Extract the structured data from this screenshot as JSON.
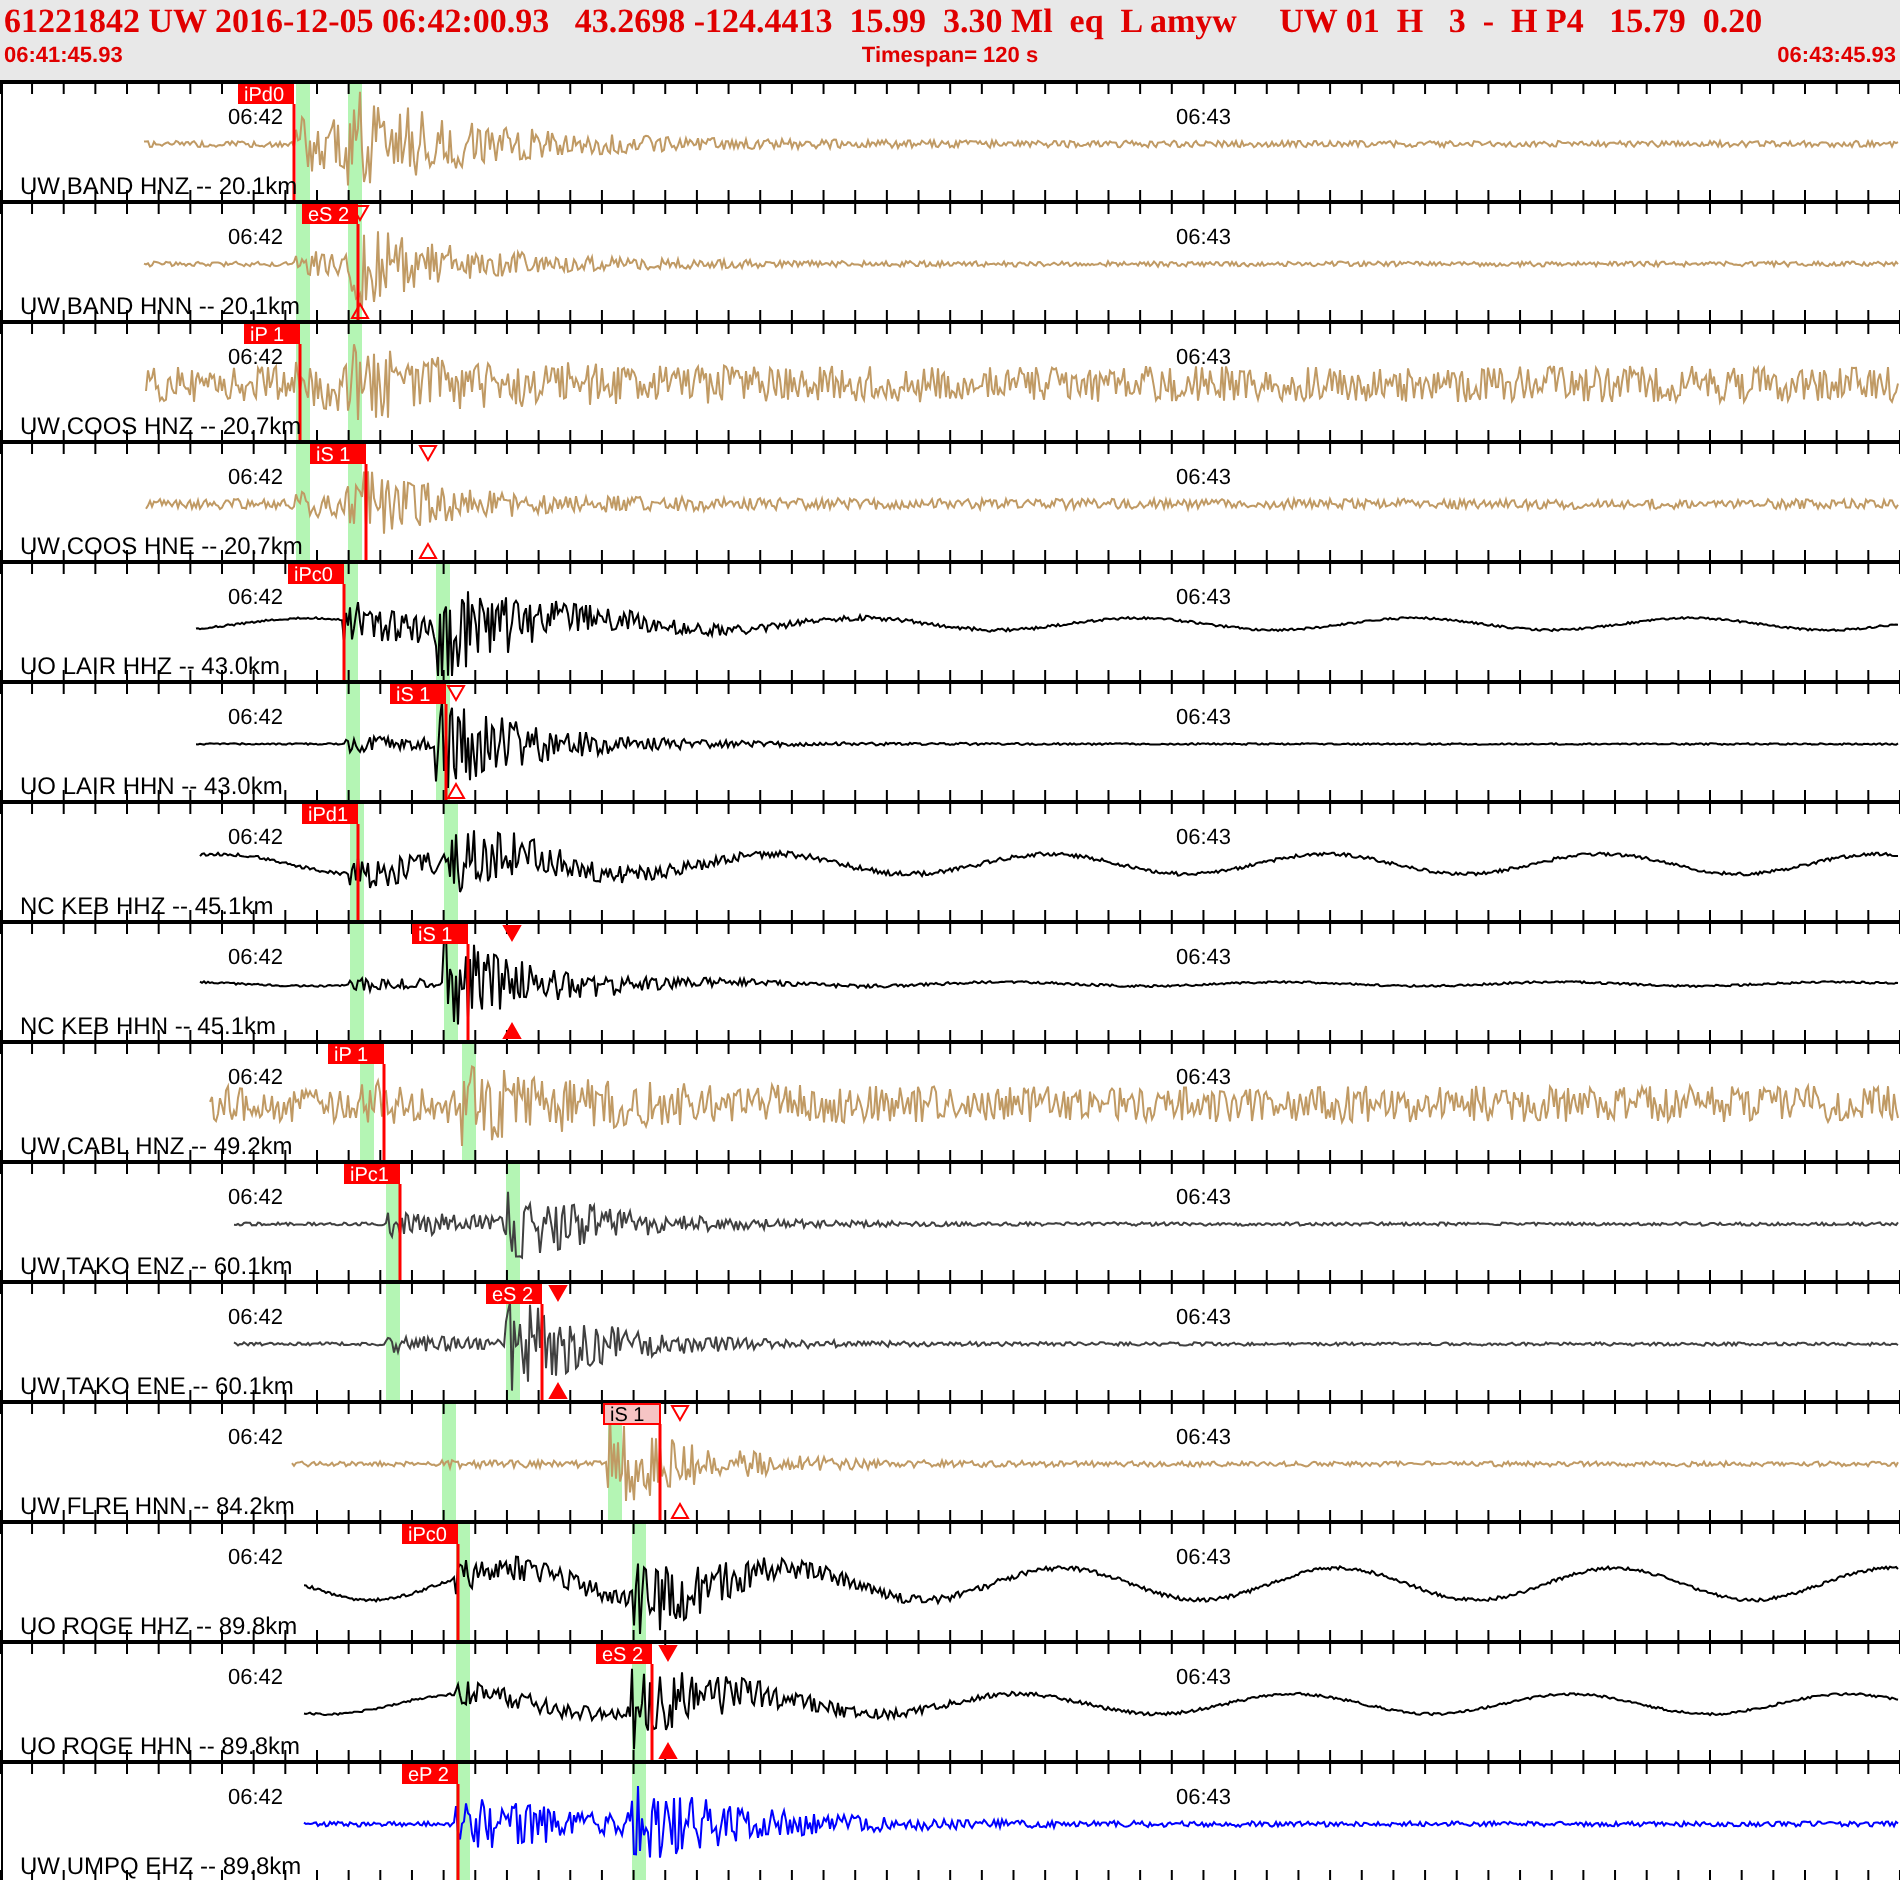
{
  "header": {
    "title": "61221842 UW 2016-12-05 06:42:00.93   43.2698 -124.4413  15.99  3.30 Ml  eq  L amyw     UW 01  H   3  -  H P4   15.79  0.20",
    "start_time": "06:41:45.93",
    "timespan": "Timespan= 120 s",
    "end_time": "06:43:45.93"
  },
  "traces": [
    {
      "label": "UW BAND HNZ -- 20.1km",
      "color": "#c09a64",
      "time_labels": [
        "06:42",
        "06:43"
      ],
      "picks": [
        {
          "label": "iPd0",
          "kind": "solid"
        }
      ]
    },
    {
      "label": "UW BAND HNN -- 20.1km",
      "color": "#c09a64",
      "time_labels": [
        "06:42",
        "06:43"
      ],
      "picks": [
        {
          "label": "eS 2",
          "kind": "solid"
        }
      ],
      "marker": {
        "kind": "outline"
      }
    },
    {
      "label": "UW COOS HNZ -- 20.7km",
      "color": "#c09a64",
      "time_labels": [
        "06:42",
        "06:43"
      ],
      "picks": [
        {
          "label": "iP 1",
          "kind": "solid"
        }
      ]
    },
    {
      "label": "UW COOS HNE -- 20.7km",
      "color": "#c09a64",
      "time_labels": [
        "06:42",
        "06:43"
      ],
      "picks": [
        {
          "label": "iS 1",
          "kind": "solid"
        }
      ],
      "marker": {
        "kind": "outline"
      }
    },
    {
      "label": "UO LAIR HHZ -- 43.0km",
      "color": "#000000",
      "time_labels": [
        "06:42",
        "06:43"
      ],
      "picks": [
        {
          "label": "iPc0",
          "kind": "solid"
        }
      ]
    },
    {
      "label": "UO LAIR HHN -- 43.0km",
      "color": "#000000",
      "time_labels": [
        "06:42",
        "06:43"
      ],
      "picks": [
        {
          "label": "iS 1",
          "kind": "solid"
        }
      ],
      "marker": {
        "kind": "outline"
      }
    },
    {
      "label": "NC KEB HHZ -- 45.1km",
      "color": "#000000",
      "time_labels": [
        "06:42",
        "06:43"
      ],
      "picks": [
        {
          "label": "iPd1",
          "kind": "solid"
        }
      ]
    },
    {
      "label": "NC KEB HHN -- 45.1km",
      "color": "#000000",
      "time_labels": [
        "06:42",
        "06:43"
      ],
      "picks": [
        {
          "label": "iS 1",
          "kind": "solid"
        }
      ],
      "marker": {
        "kind": "filled"
      }
    },
    {
      "label": "UW CABL HNZ -- 49.2km",
      "color": "#c09a64",
      "time_labels": [
        "06:42",
        "06:43"
      ],
      "picks": [
        {
          "label": "iP 1",
          "kind": "solid"
        }
      ]
    },
    {
      "label": "UW TAKO ENZ -- 60.1km",
      "color": "#404040",
      "time_labels": [
        "06:42",
        "06:43"
      ],
      "picks": [
        {
          "label": "iPc1",
          "kind": "solid"
        }
      ]
    },
    {
      "label": "UW TAKO ENE -- 60.1km",
      "color": "#404040",
      "time_labels": [
        "06:42",
        "06:43"
      ],
      "picks": [
        {
          "label": "eS 2",
          "kind": "solid"
        }
      ],
      "marker": {
        "kind": "filled"
      }
    },
    {
      "label": "UW FLRE HNN -- 84.2km",
      "color": "#c09a64",
      "time_labels": [
        "06:42",
        "06:43"
      ],
      "picks": [
        {
          "label": "iS 1",
          "kind": "pale"
        }
      ],
      "marker": {
        "kind": "outline"
      }
    },
    {
      "label": "UO ROGE HHZ -- 89.8km",
      "color": "#000000",
      "time_labels": [
        "06:42",
        "06:43"
      ],
      "picks": [
        {
          "label": "iPc0",
          "kind": "solid"
        }
      ]
    },
    {
      "label": "UO ROGE HHN -- 89.8km",
      "color": "#000000",
      "time_labels": [
        "06:42",
        "06:43"
      ],
      "picks": [
        {
          "label": "eS 2",
          "kind": "solid"
        }
      ],
      "marker": {
        "kind": "filled"
      }
    },
    {
      "label": "UW UMPQ EHZ -- 89.8km",
      "color": "#0000ff",
      "time_labels": [
        "06:42",
        "06:43"
      ],
      "picks": [
        {
          "label": "eP 2",
          "kind": "solid"
        }
      ]
    }
  ]
}
